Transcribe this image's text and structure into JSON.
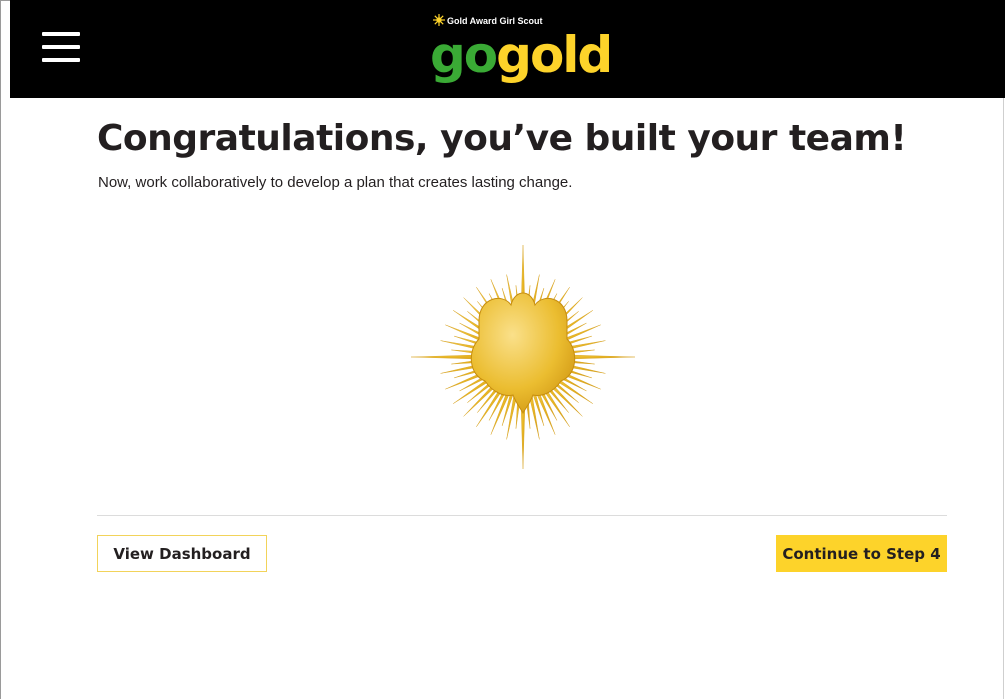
{
  "header": {
    "menu_icon": "hamburger-menu-icon",
    "logo": {
      "tagline": "Gold Award Girl Scout",
      "word_go": "go",
      "word_gold": "gold",
      "colors": {
        "go": "#3aaa35",
        "gold": "#fdd32a",
        "background": "#000000"
      }
    }
  },
  "main": {
    "title": "Congratulations, you’ve built your team!",
    "subtitle": "Now, work collaboratively to develop a plan that creates lasting change.",
    "badge_icon": "gold-award-trefoil-sunburst-icon"
  },
  "actions": {
    "view_dashboard_label": "View Dashboard",
    "continue_label": "Continue to Step 4"
  },
  "colors": {
    "accent_yellow": "#fdd32a",
    "text": "#231f20"
  }
}
